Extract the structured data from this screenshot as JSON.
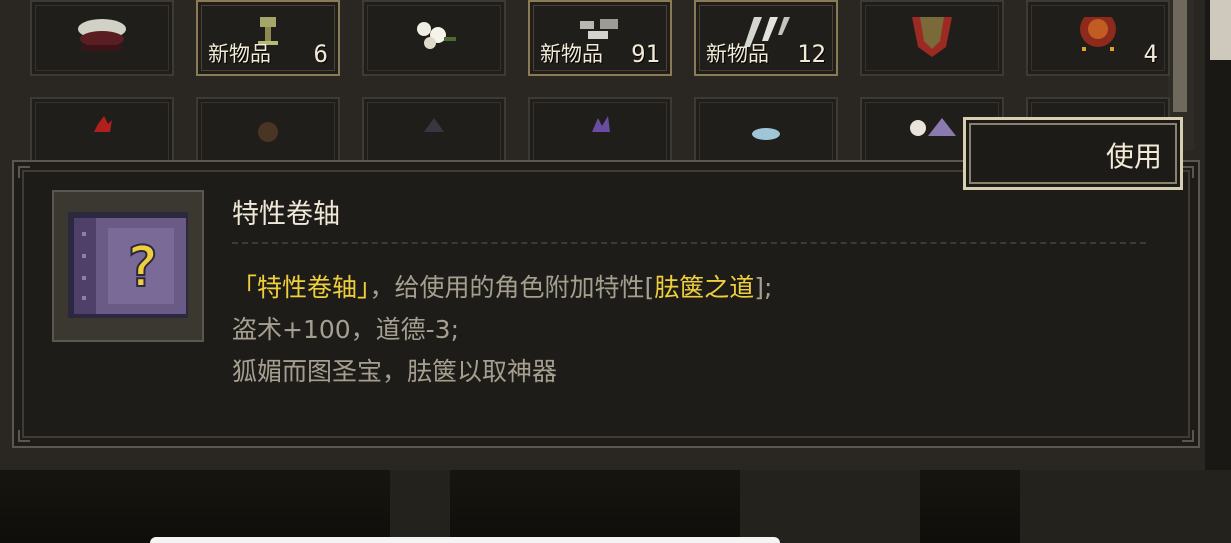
{
  "inventory": {
    "row1": [
      {
        "art": "pottery-bowl-icon",
        "tag": "",
        "count": ""
      },
      {
        "art": "golden-goblet-icon",
        "tag": "新物品",
        "count": "6"
      },
      {
        "art": "white-flowers-icon",
        "tag": "",
        "count": ""
      },
      {
        "art": "silver-ore-icon",
        "tag": "新物品",
        "count": "91"
      },
      {
        "art": "silver-blades-icon",
        "tag": "新物品",
        "count": "12"
      },
      {
        "art": "bronze-shield-icon",
        "tag": "",
        "count": ""
      },
      {
        "art": "red-seal-icon",
        "tag": "",
        "count": "4"
      }
    ],
    "row2": [
      {
        "art": "red-herb-icon"
      },
      {
        "art": "brown-orb-icon"
      },
      {
        "art": "dark-gem-icon"
      },
      {
        "art": "purple-herb-icon"
      },
      {
        "art": "blue-crystal-icon"
      },
      {
        "art": "skull-pile-icon"
      },
      {
        "art": "red-item-icon"
      }
    ]
  },
  "use_button": {
    "label": "使用"
  },
  "tooltip": {
    "item_icon": "trait-scroll-icon",
    "item_name": "特性卷轴",
    "desc1": {
      "quoted_name": "「特性卷轴」",
      "middle": "，给使用的角色附加特性[",
      "trait": "胠箧之道",
      "end": "];"
    },
    "desc2": "盗术+100，道德-3;",
    "desc3": "狐媚而图圣宝，胠箧以取神器"
  },
  "colors": {
    "highlight": "#f0cf3c",
    "text_muted": "#a59f90",
    "text_light": "#efe8d7",
    "panel_bg": "#1e1c19",
    "border": "#5b574e"
  }
}
